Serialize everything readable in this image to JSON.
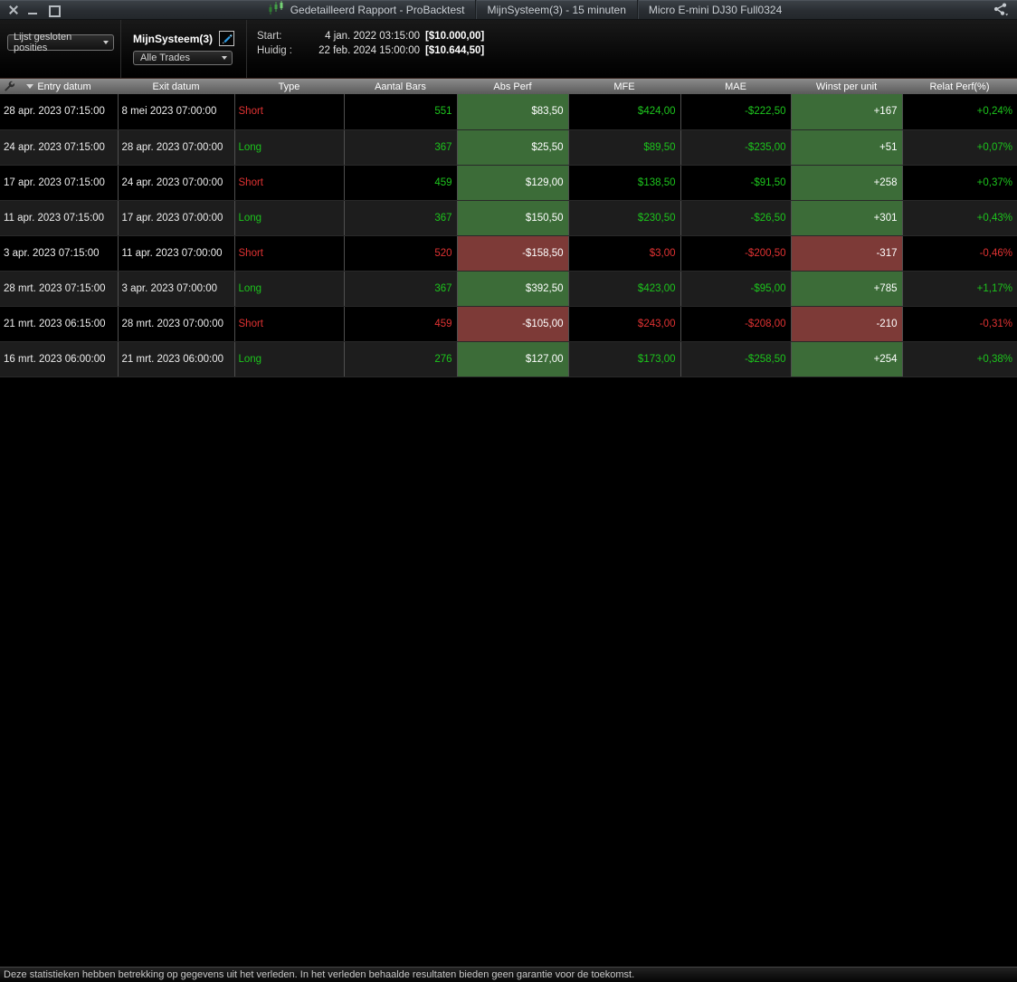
{
  "window": {
    "title": "Gedetailleerd Rapport - ProBacktest",
    "tab_system": "MijnSysteem(3) - 15 minuten",
    "tab_instrument": "Micro E-mini DJ30 Full0324"
  },
  "toolbar": {
    "view_select": "Lijst gesloten posities",
    "system_name": "MijnSysteem(3)",
    "trades_filter": "Alle Trades",
    "start_label": "Start:",
    "start_datetime": "4 jan. 2022 03:15:00",
    "start_value": "[$10.000,00]",
    "current_label": "Huidig :",
    "current_datetime": "22 feb. 2024 15:00:00",
    "current_value": "[$10.644,50]"
  },
  "table": {
    "columns": [
      "Entry datum",
      "Exit datum",
      "Type",
      "Aantal Bars",
      "Abs Perf",
      "MFE",
      "MAE",
      "Winst per unit",
      "Relat Perf(%)"
    ],
    "rows": [
      {
        "entry": "28 apr. 2023 07:15:00",
        "exit": "8 mei 2023 07:00:00",
        "type": "Short",
        "bars": "551",
        "abs_perf": "$83,50",
        "mfe": "$424,00",
        "mae": "-$222,50",
        "winst_per_unit": "+167",
        "relat_perf": "+0,24%",
        "result": "win"
      },
      {
        "entry": "24 apr. 2023 07:15:00",
        "exit": "28 apr. 2023 07:00:00",
        "type": "Long",
        "bars": "367",
        "abs_perf": "$25,50",
        "mfe": "$89,50",
        "mae": "-$235,00",
        "winst_per_unit": "+51",
        "relat_perf": "+0,07%",
        "result": "win"
      },
      {
        "entry": "17 apr. 2023 07:15:00",
        "exit": "24 apr. 2023 07:00:00",
        "type": "Short",
        "bars": "459",
        "abs_perf": "$129,00",
        "mfe": "$138,50",
        "mae": "-$91,50",
        "winst_per_unit": "+258",
        "relat_perf": "+0,37%",
        "result": "win"
      },
      {
        "entry": "11 apr. 2023 07:15:00",
        "exit": "17 apr. 2023 07:00:00",
        "type": "Long",
        "bars": "367",
        "abs_perf": "$150,50",
        "mfe": "$230,50",
        "mae": "-$26,50",
        "winst_per_unit": "+301",
        "relat_perf": "+0,43%",
        "result": "win"
      },
      {
        "entry": "3 apr. 2023 07:15:00",
        "exit": "11 apr. 2023 07:00:00",
        "type": "Short",
        "bars": "520",
        "abs_perf": "-$158,50",
        "mfe": "$3,00",
        "mae": "-$200,50",
        "winst_per_unit": "-317",
        "relat_perf": "-0,46%",
        "result": "loss"
      },
      {
        "entry": "28 mrt. 2023 07:15:00",
        "exit": "3 apr. 2023 07:00:00",
        "type": "Long",
        "bars": "367",
        "abs_perf": "$392,50",
        "mfe": "$423,00",
        "mae": "-$95,00",
        "winst_per_unit": "+785",
        "relat_perf": "+1,17%",
        "result": "win"
      },
      {
        "entry": "21 mrt. 2023 06:15:00",
        "exit": "28 mrt. 2023 07:00:00",
        "type": "Short",
        "bars": "459",
        "abs_perf": "-$105,00",
        "mfe": "$243,00",
        "mae": "-$208,00",
        "winst_per_unit": "-210",
        "relat_perf": "-0,31%",
        "result": "loss"
      },
      {
        "entry": "16 mrt. 2023 06:00:00",
        "exit": "21 mrt. 2023 06:00:00",
        "type": "Long",
        "bars": "276",
        "abs_perf": "$127,00",
        "mfe": "$173,00",
        "mae": "-$258,50",
        "winst_per_unit": "+254",
        "relat_perf": "+0,38%",
        "result": "win"
      }
    ]
  },
  "footer": {
    "disclaimer": "Deze statistieken hebben betrekking op gegevens uit het verleden. In het verleden behaalde resultaten bieden geen garantie voor de toekomst."
  },
  "colors": {
    "win_text": "#1dc51d",
    "loss_text": "#e03232",
    "win_bg": "#3c6c38",
    "loss_bg": "#7d3a37",
    "accent_blue": "#2e9ae0"
  }
}
